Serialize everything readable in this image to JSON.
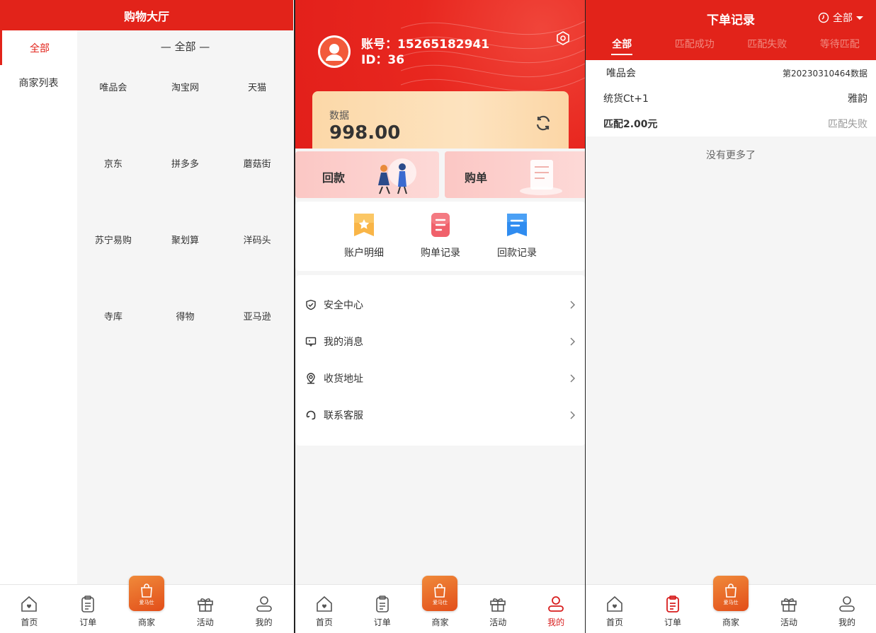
{
  "colors": {
    "primary": "#e2231a",
    "active": "#d81e1e",
    "muted": "#999999"
  },
  "tabbar": {
    "items": [
      {
        "label": "首页",
        "icon": "home-icon"
      },
      {
        "label": "订单",
        "icon": "clipboard-icon"
      },
      {
        "label": "商家",
        "icon": "shopping-bag-icon"
      },
      {
        "label": "活动",
        "icon": "gift-icon"
      },
      {
        "label": "我的",
        "icon": "user-icon"
      }
    ],
    "brand": "爱马仕"
  },
  "shop_hall": {
    "title": "购物大厅",
    "sidebar": [
      {
        "label": "全部"
      },
      {
        "label": "商家列表"
      }
    ],
    "section_title": "— 全部 —",
    "merchants": [
      "唯品会",
      "淘宝网",
      "天猫",
      "京东",
      "拼多多",
      "蘑菇街",
      "苏宁易购",
      "聚划算",
      "洋码头",
      "寺库",
      "得物",
      "亚马逊"
    ]
  },
  "profile": {
    "account_line": "账号：15265182941",
    "id_line": "ID：36",
    "balance_label": "数据",
    "balance_value": "998.00",
    "actions": [
      {
        "label": "回款"
      },
      {
        "label": "购单"
      }
    ],
    "quick_links": [
      {
        "label": "账户明细",
        "icon": "account-detail-icon"
      },
      {
        "label": "购单记录",
        "icon": "purchase-record-icon"
      },
      {
        "label": "回款记录",
        "icon": "refund-record-icon"
      }
    ],
    "menu": [
      {
        "label": "安全中心",
        "icon": "shield-check-icon"
      },
      {
        "label": "我的消息",
        "icon": "message-icon"
      },
      {
        "label": "收货地址",
        "icon": "location-icon"
      },
      {
        "label": "联系客服",
        "icon": "headset-icon"
      }
    ]
  },
  "orders": {
    "title": "下单记录",
    "filter": "全部",
    "tabs": [
      "全部",
      "匹配成功",
      "匹配失败",
      "等待匹配"
    ],
    "items": [
      {
        "merchant": "唯品会",
        "order_no": "第20230310464数据",
        "product": "统货Ct+1",
        "brand": "雅韵",
        "amount": "匹配2.00元",
        "status": "匹配失败"
      }
    ],
    "no_more": "没有更多了"
  }
}
